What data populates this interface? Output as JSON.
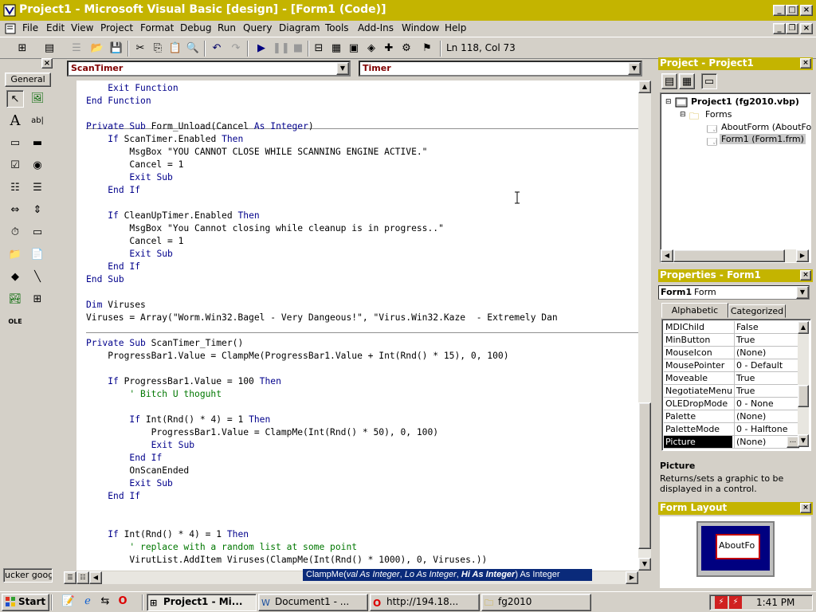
{
  "window": {
    "title": "Project1 - Microsoft Visual Basic [design] - [Form1 (Code)]"
  },
  "menu": [
    "File",
    "Edit",
    "View",
    "Project",
    "Format",
    "Debug",
    "Run",
    "Query",
    "Diagram",
    "Tools",
    "Add-Ins",
    "Window",
    "Help"
  ],
  "toolbar": {
    "position": "Ln 118, Col 73"
  },
  "toolbox": {
    "title": "General",
    "bottom_label": "ucker googl"
  },
  "code": {
    "object_combo": "ScanTimer",
    "proc_combo": "Timer",
    "lines": [
      "    Exit Function",
      "End Function",
      "",
      "Private Sub Form_Unload(Cancel As Integer)",
      "    If ScanTimer.Enabled Then",
      "        MsgBox \"YOU CANNOT CLOSE WHILE SCANNING ENGINE ACTIVE.\"",
      "        Cancel = 1",
      "        Exit Sub",
      "    End If",
      "",
      "    If CleanUpTimer.Enabled Then",
      "        MsgBox \"You Cannot closing while cleanup is in progress..\"",
      "        Cancel = 1",
      "        Exit Sub",
      "    End If",
      "End Sub",
      "",
      "Dim Viruses",
      "Viruses = Array(\"Worm.Win32.Bagel - Very Dangeous!\", \"Virus.Win32.Kaze  - Extremely Dan",
      "",
      "Private Sub ScanTimer_Timer()",
      "    ProgressBar1.Value = ClampMe(ProgressBar1.Value + Int(Rnd() * 15), 0, 100)",
      "",
      "    If ProgressBar1.Value = 100 Then",
      "        ' Bitch U thoguht",
      "",
      "        If Int(Rnd() * 4) = 1 Then",
      "            ProgressBar1.Value = ClampMe(Int(Rnd() * 50), 0, 100)",
      "            Exit Sub",
      "        End If",
      "        OnScanEnded",
      "        Exit Sub",
      "    End If",
      "",
      "",
      "    If Int(Rnd() * 4) = 1 Then",
      "        ' replace with a random list at some point",
      "        VirutList.AddItem Viruses(ClampMe(Int(Rnd() * 1000), 0, Viruses.))"
    ],
    "tooltip": {
      "fn": "ClampMe(",
      "p1": "val As Integer",
      "sep1": ", ",
      "p2": "Lo As Integer",
      "sep2": ", ",
      "p3": "Hi As Integer",
      "end": ") As Integer"
    }
  },
  "project": {
    "title": "Project - Project1",
    "root": "Project1 (fg2010.vbp)",
    "folder": "Forms",
    "items": [
      "AboutForm (AboutForm",
      "Form1 (Form1.frm)"
    ]
  },
  "properties": {
    "title": "Properties - Form1",
    "object": "Form1",
    "object_type": "Form",
    "tabs": [
      "Alphabetic",
      "Categorized"
    ],
    "rows": [
      {
        "name": "MDIChild",
        "value": "False"
      },
      {
        "name": "MinButton",
        "value": "True"
      },
      {
        "name": "MouseIcon",
        "value": "(None)"
      },
      {
        "name": "MousePointer",
        "value": "0 - Default"
      },
      {
        "name": "Moveable",
        "value": "True"
      },
      {
        "name": "NegotiateMenus",
        "value": "True"
      },
      {
        "name": "OLEDropMode",
        "value": "0 - None"
      },
      {
        "name": "Palette",
        "value": "(None)"
      },
      {
        "name": "PaletteMode",
        "value": "0 - Halftone"
      },
      {
        "name": "Picture",
        "value": "(None)"
      }
    ],
    "desc_title": "Picture",
    "desc_text": "Returns/sets a graphic to be displayed in a control."
  },
  "form_layout": {
    "title": "Form Layout",
    "preview": "AboutFo"
  },
  "taskbar": {
    "start": "Start",
    "buttons": [
      "Project1 - Mi...",
      "Document1 - ...",
      "http://194.18...",
      "fg2010"
    ],
    "clock": "1:41 PM"
  },
  "colors": {
    "caption": "#c4b400",
    "desktop": "#d4d0c8",
    "keyword": "#00008b",
    "comment": "#007700"
  }
}
